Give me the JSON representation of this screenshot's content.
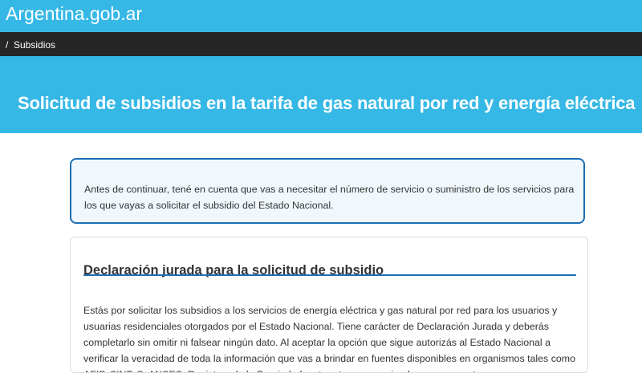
{
  "header": {
    "site_title": "Argentina.gob.ar"
  },
  "breadcrumb": {
    "separator": "/",
    "items": [
      {
        "label": "Subsidios"
      }
    ]
  },
  "hero": {
    "title": "Solicitud de subsidios en la tarifa de gas natural por red y energía eléctrica"
  },
  "notice": {
    "text": "Antes de continuar, tené en cuenta que vas a necesitar el número de servicio o suministro de los servicios para los que vayas a solicitar el subsidio del Estado Nacional."
  },
  "declaration": {
    "title": "Declaración jurada para la solicitud de subsidio",
    "body": "Estás por solicitar los subsidios a los servicios de energía eléctrica y gas natural por red para los usuarios y usuarias residenciales otorgados por el Estado Nacional. Tiene carácter de Declaración Jurada y deberás completarlo sin omitir ni falsear ningún dato. Al aceptar la opción que sigue autorizás al Estado Nacional a verificar la veracidad de toda la información que vas a brindar en fuentes disponibles en organismos tales como AFIP, SINTyS, ANSES, Registros de la Propiedad, entre otros, renunciando expresamente a oponer a"
  },
  "colors": {
    "brand_blue": "#36b8e6",
    "dark_bar": "#262626",
    "accent_blue": "#1b6eb5",
    "notice_background": "#f1f8fd",
    "text": "#333333"
  }
}
